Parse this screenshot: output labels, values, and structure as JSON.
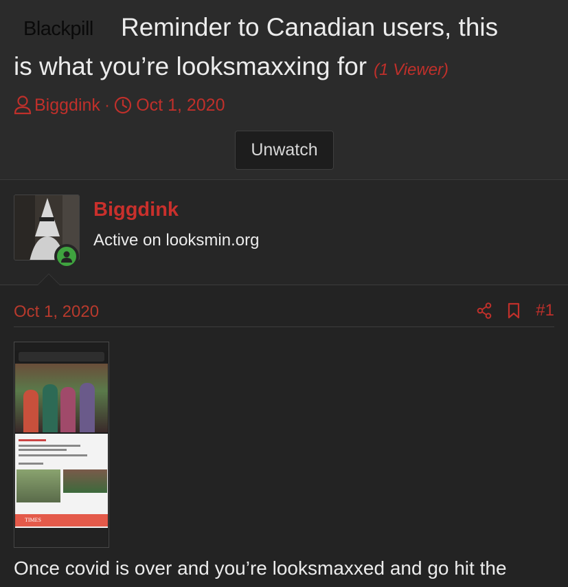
{
  "thread": {
    "prefix": "Blackpill",
    "title_line1": "Reminder to Canadian users, this",
    "title_line2": "is what you’re looksmaxxing for",
    "viewers": "(1 Viewer)",
    "author": "Biggdink",
    "separator": "·",
    "date": "Oct 1, 2020",
    "watch_button": "Unwatch"
  },
  "post": {
    "username": "Biggdink",
    "user_title": "Active on looksmin.org",
    "date": "Oct 1, 2020",
    "post_number": "#1",
    "attachment_brand": "TIMES",
    "body_text": "Once covid is over and you’re looksmaxxed and go hit the"
  },
  "colors": {
    "accent": "#c0302b",
    "background": "#232323",
    "header_bg": "#2b2b2b",
    "online": "#3fa33f"
  },
  "icons": {
    "author": "user-icon",
    "date": "clock-icon",
    "share": "share-icon",
    "bookmark": "bookmark-icon",
    "online": "online-user-icon"
  }
}
